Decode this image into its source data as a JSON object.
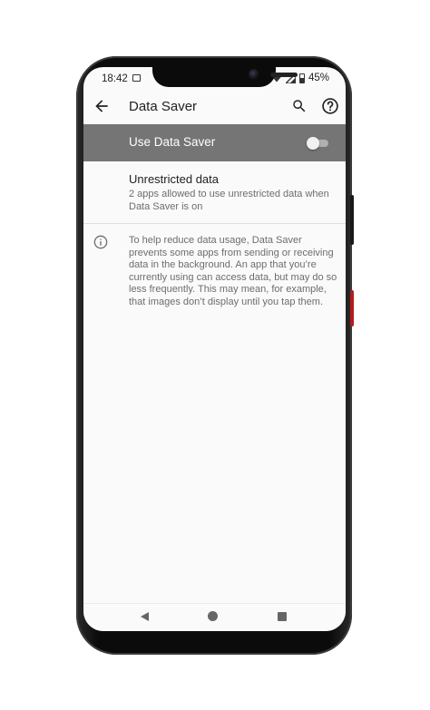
{
  "status_bar": {
    "time": "18:42",
    "battery": "45%"
  },
  "app_bar": {
    "title": "Data Saver"
  },
  "master_switch": {
    "label": "Use Data Saver",
    "enabled": false
  },
  "unrestricted": {
    "title": "Unrestricted data",
    "summary": "2 apps allowed to use unrestricted data when Data Saver is on"
  },
  "footer": {
    "text": "To help reduce data usage, Data Saver prevents some apps from sending or receiving data in the background. An app that you’re currently using can access data, but may do so less frequently. This may mean, for example, that images don’t display until you tap them."
  },
  "icons": {
    "back": "arrow-back-icon",
    "search": "search-icon",
    "help": "help-icon",
    "info": "info-icon"
  },
  "colors": {
    "switch_bar_bg": "#757575",
    "background": "#fafafa",
    "primary_text": "#202124",
    "secondary_text": "#6d6d6d"
  }
}
